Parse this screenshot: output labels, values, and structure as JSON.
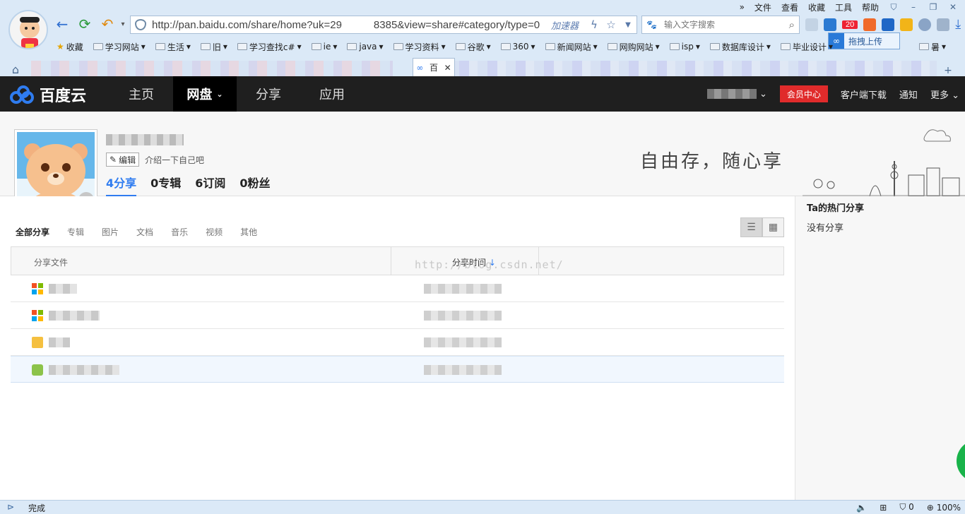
{
  "browser": {
    "menu": [
      "文件",
      "查看",
      "收藏",
      "工具",
      "帮助"
    ],
    "url": "http://pan.baidu.com/share/home?uk=29   8385&view=share#category/type=0",
    "accelerator": "加速器",
    "search_placeholder": "输入文字搜索",
    "ext_badge": "20",
    "upload_label": "拖拽上传",
    "bookmarks": [
      "收藏",
      "学习网站",
      "生活",
      "旧",
      "学习查找c#",
      "ie",
      "java",
      "学习资料",
      "谷歌",
      "360",
      "新闻网站",
      "网购网站",
      "isp",
      "数据库设计",
      "毕业设计"
    ],
    "bookmark_trailing": "暑",
    "active_tab_label": "百",
    "status_text": "完成",
    "zoom": "100%",
    "status_count": "0"
  },
  "site": {
    "brand": "百度云",
    "nav": [
      "主页",
      "网盘",
      "分享",
      "应用"
    ],
    "member_center": "会员中心",
    "client_download": "客户端下载",
    "notify": "通知",
    "more": "更多"
  },
  "profile": {
    "edit_label": "编辑",
    "intro": "介绍一下自己吧",
    "stats": [
      "4分享",
      "0专辑",
      "6订阅",
      "0粉丝"
    ],
    "slogan": "自由存，随心享"
  },
  "content": {
    "filters": [
      "全部分享",
      "专辑",
      "图片",
      "文档",
      "音乐",
      "视频",
      "其他"
    ],
    "col_file": "分享文件",
    "col_time": "分享时间",
    "watermark": "http://blog.csdn.net/"
  },
  "sidebar": {
    "title": "Ta的热门分享",
    "empty": "没有分享"
  },
  "colors": {
    "brand_blue": "#2f7cf0",
    "header_bg": "#1f1f1f",
    "member_red": "#e02b2b"
  }
}
